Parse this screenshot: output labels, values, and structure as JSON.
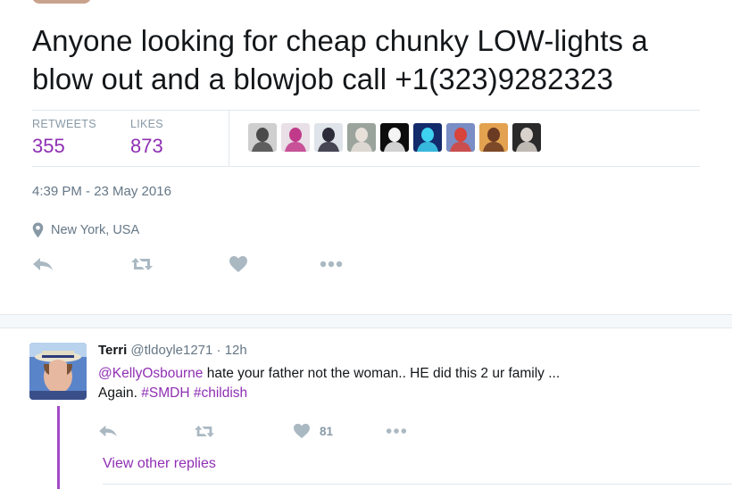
{
  "tweet": {
    "text_line1": "Anyone looking for cheap chunky LOW-lights a",
    "text_line2": "blow out and a blowjob call +1(323)9282323",
    "retweets_label": "RETWEETS",
    "retweets_count": "355",
    "likes_label": "LIKES",
    "likes_count": "873",
    "timestamp": "4:39 PM - 23 May 2016",
    "location": "New York, USA",
    "liker_avatars": [
      {
        "name": "liker-avatar-1",
        "bg": "#cfcfcf",
        "fg": "#4a4a4a"
      },
      {
        "name": "liker-avatar-2",
        "bg": "#e9dfe6",
        "fg": "#c13a8a"
      },
      {
        "name": "liker-avatar-3",
        "bg": "#dfe3ea",
        "fg": "#2b2b3a"
      },
      {
        "name": "liker-avatar-4",
        "bg": "#9aa39c",
        "fg": "#e7e1da"
      },
      {
        "name": "liker-avatar-5",
        "bg": "#0d0d0d",
        "fg": "#f4f4f4"
      },
      {
        "name": "liker-avatar-6",
        "bg": "#132a6b",
        "fg": "#3fd1f0"
      },
      {
        "name": "liker-avatar-7",
        "bg": "#7a8dc4",
        "fg": "#d8433a"
      },
      {
        "name": "liker-avatar-8",
        "bg": "#e3a24f",
        "fg": "#6b3a22"
      },
      {
        "name": "liker-avatar-9",
        "bg": "#2a2a2a",
        "fg": "#d9d2cc"
      }
    ]
  },
  "reply": {
    "name": "Terri",
    "handle": "@tldoyle1271",
    "separator": "·",
    "time": "12h",
    "mention": "@KellyOsbourne",
    "text_after_mention": " hate your father not the woman.. HE did this 2 ur family ...",
    "text_line2_prefix": "Again. ",
    "hashtag1": "#SMDH",
    "hashtag2": "#childish",
    "like_count": "81",
    "view_other_replies": "View other replies"
  },
  "colors": {
    "accent": "#8f2fb3",
    "icon_gray": "#aab8c2",
    "text_dark": "#14171a",
    "text_muted": "#657786"
  }
}
